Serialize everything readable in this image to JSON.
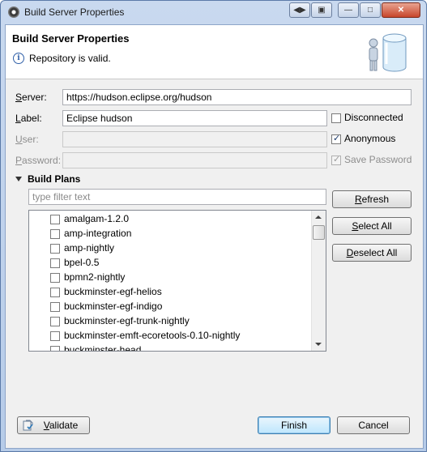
{
  "window": {
    "title": "Build Server Properties",
    "controls": [
      "◀▶",
      "▣",
      "—",
      "□",
      "✕"
    ]
  },
  "banner": {
    "title": "Build Server Properties",
    "message": "Repository is valid."
  },
  "form": {
    "server_label_u": "S",
    "server_label_rest": "erver:",
    "server_value": "https://hudson.eclipse.org/hudson",
    "label_label_u": "L",
    "label_label_rest": "abel:",
    "label_value": "Eclipse hudson",
    "user_label_u": "U",
    "user_label_rest": "ser:",
    "user_value": "",
    "password_label_u": "P",
    "password_label_rest": "assword:",
    "password_value": "",
    "disconnected_label": "Disconnected",
    "disconnected_checked": false,
    "anonymous_label": "Anonymous",
    "anonymous_checked": true,
    "save_password_label": "Save Password",
    "save_password_checked": true
  },
  "build_plans": {
    "section_label": "Build Plans",
    "filter_placeholder": "type filter text",
    "refresh_u": "R",
    "refresh_rest": "efresh",
    "select_all_u": "S",
    "select_all_rest": "elect All",
    "deselect_all_u": "D",
    "deselect_all_rest": "eselect All",
    "items": [
      "amalgam-1.2.0",
      "amp-integration",
      "amp-nightly",
      "bpel-0.5",
      "bpmn2-nightly",
      "buckminster-egf-helios",
      "buckminster-egf-indigo",
      "buckminster-egf-trunk-nightly",
      "buckminster-emft-ecoretools-0.10-nightly",
      "buckminster-head"
    ]
  },
  "footer": {
    "validate_u": "V",
    "validate_rest": "alidate",
    "finish_label": "Finish",
    "cancel_label": "Cancel"
  }
}
